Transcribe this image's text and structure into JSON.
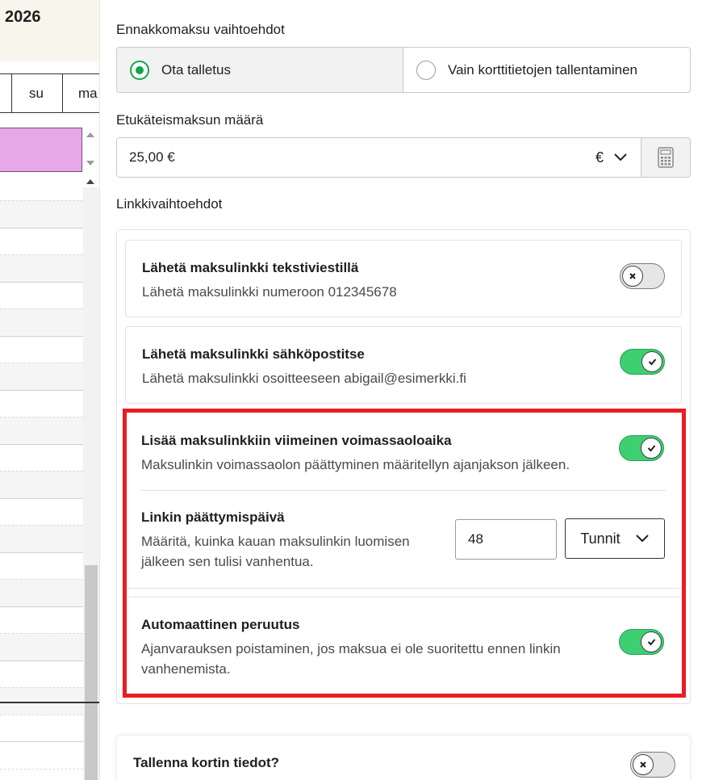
{
  "calendar": {
    "year_text": "2026",
    "day_su": "su",
    "day_ma": "ma",
    "event_color": "#e8a8e8"
  },
  "deposit": {
    "section_label": "Ennakkomaksu vaihtoehdot",
    "options": [
      {
        "label": "Ota talletus",
        "selected": true
      },
      {
        "label": "Vain korttitietojen tallentaminen",
        "selected": false
      }
    ]
  },
  "amount": {
    "label": "Etukäteismaksun määrä",
    "value": "25,00 €",
    "currency": "€",
    "calculator_icon": "calculator-icon"
  },
  "links": {
    "section_label": "Linkkivaihtoehdot",
    "sms": {
      "title": "Lähetä maksulinkki tekstiviestillä",
      "description": "Lähetä maksulinkki numeroon 012345678",
      "enabled": false
    },
    "email": {
      "title": "Lähetä maksulinkki sähköpostitse",
      "description": "Lähetä maksulinkki osoitteeseen abigail@esimerkki.fi",
      "enabled": true
    },
    "expiry": {
      "title": "Lisää maksulinkkiin viimeinen voimassaoloaika",
      "description": "Maksulinkin voimassaolon päättyminen määritellyn ajanjakson jälkeen.",
      "enabled": true
    },
    "end_date": {
      "title": "Linkin päättymispäivä",
      "description_line1": "Määritä, kuinka kauan maksulinkin luomisen",
      "description_line2": "jälkeen sen tulisi vanhentua.",
      "value": "48",
      "unit": "Tunnit"
    },
    "auto_cancel": {
      "title": "Automaattinen peruutus",
      "description_line1": "Ajanvarauksen poistaminen, jos maksua ei ole suoritettu ennen linkin",
      "description_line2": "vanhenemista.",
      "enabled": true
    }
  },
  "save_card": {
    "title": "Tallenna kortin tiedot?",
    "enabled": false
  },
  "colors": {
    "accent_green": "#3ecf72",
    "radio_green": "#17a34a",
    "highlight_red": "#ea1c24"
  }
}
